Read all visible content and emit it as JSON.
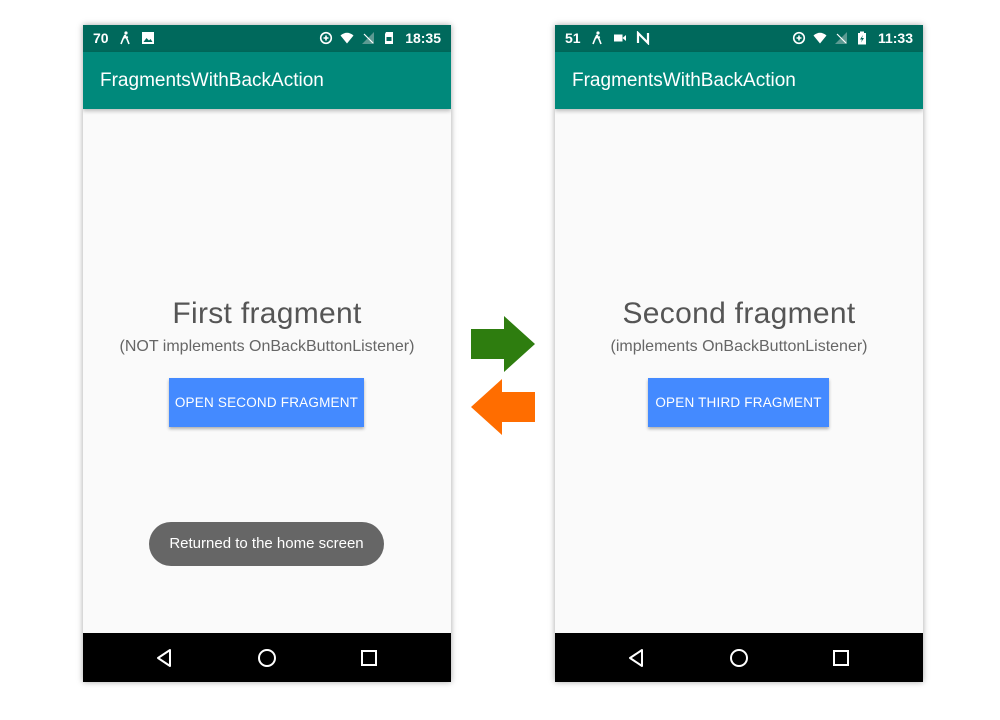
{
  "left_phone": {
    "status": {
      "battery_level": "70",
      "time": "18:35"
    },
    "app_title": "FragmentsWithBackAction",
    "fragment_title": "First fragment",
    "fragment_subtitle": "(NOT implements OnBackButtonListener)",
    "button_label": "OPEN SECOND FRAGMENT",
    "toast": "Returned to the home screen"
  },
  "right_phone": {
    "status": {
      "battery_level": "51",
      "time": "11:33"
    },
    "app_title": "FragmentsWithBackAction",
    "fragment_title": "Second fragment",
    "fragment_subtitle": "(implements OnBackButtonListener)",
    "button_label": "OPEN THIRD FRAGMENT"
  },
  "icons": {
    "status_left": [
      "accessibility-icon",
      "image-icon"
    ],
    "status_left_right_phone": [
      "accessibility-icon",
      "video-icon",
      "n-icon"
    ],
    "status_right": [
      "data-saver-icon",
      "wifi-icon",
      "no-signal-icon",
      "sd-card-icon"
    ],
    "nav": [
      "back-triangle-icon",
      "home-circle-icon",
      "recents-square-icon"
    ]
  },
  "colors": {
    "status_bar": "#00695c",
    "app_bar": "#00897b",
    "button": "#448aff",
    "toast": "#666666",
    "forward_arrow": "#2e7d0f",
    "back_arrow": "#ff6d00"
  }
}
